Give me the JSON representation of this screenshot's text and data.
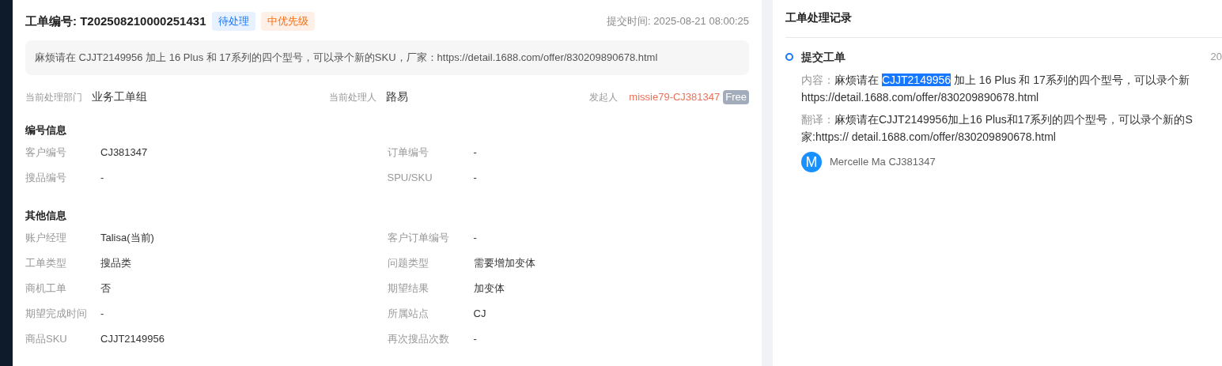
{
  "ticket": {
    "title": "工单编号: T202508210000251431",
    "tags": [
      {
        "text": "待处理",
        "color": "#1677ff"
      },
      {
        "text": "中优先级",
        "color": "#fa6e14"
      }
    ],
    "submitted": "提交时间: 2025-08-21 08:00:25",
    "description": "麻烦请在 CJJT2149956 加上 16 Plus 和 17系列的四个型号，可以录个新的SKU，厂家：https://detail.1688.com/offer/830209890678.html",
    "department_label": "当前处理部门",
    "department": "业务工单组",
    "handler_label": "当前处理人",
    "handler": "路易",
    "initiator_label": "发起人",
    "initiator": "missie79-CJ381347",
    "initiator_badge": "Free",
    "sections": [
      {
        "title": "编号信息",
        "fields": [
          {
            "label": "客户编号",
            "value": "CJ381347"
          },
          {
            "label": "订单编号",
            "value": "-"
          },
          {
            "label": "搜品编号",
            "value": "-"
          },
          {
            "label": "SPU/SKU",
            "value": "-"
          }
        ]
      },
      {
        "title": "其他信息",
        "fields": [
          {
            "label": "账户经理",
            "value": "Talisa(当前)"
          },
          {
            "label": "客户订单编号",
            "value": "-"
          },
          {
            "label": "工单类型",
            "value": "搜品类"
          },
          {
            "label": "问题类型",
            "value": "需要增加变体"
          },
          {
            "label": "商机工单",
            "value": "否"
          },
          {
            "label": "期望结果",
            "value": "加变体"
          },
          {
            "label": "期望完成时间",
            "value": "-"
          },
          {
            "label": "所属站点",
            "value": "CJ"
          },
          {
            "label": "商品SKU",
            "value": "CJJT2149956"
          },
          {
            "label": "再次搜品次数",
            "value": "-"
          }
        ]
      }
    ]
  },
  "history": {
    "title": "工单处理记录",
    "records": [
      {
        "title": "提交工单",
        "time": "20",
        "content_label": "内容：",
        "content_first_line": [
          {
            "text": "麻烦请在 ",
            "highlighted": false
          },
          {
            "text": "CJJT2149956",
            "highlighted": true
          },
          {
            "text": " 加上 16 Plus 和 17系列的四个型号，可以录个新",
            "highlighted": false
          }
        ],
        "content_more_lines": [
          "https://detail.1688.com/offer/830209890678.html"
        ],
        "translation_label": "翻译：",
        "translation_lines": [
          "麻烦请在CJJT2149956加上16 Plus和17系列的四个型号，可以录个新的S",
          "家:https:// detail.1688.com/offer/830209890678.html"
        ],
        "avatar": "M",
        "author": "Mercelle Ma CJ381347"
      }
    ]
  }
}
